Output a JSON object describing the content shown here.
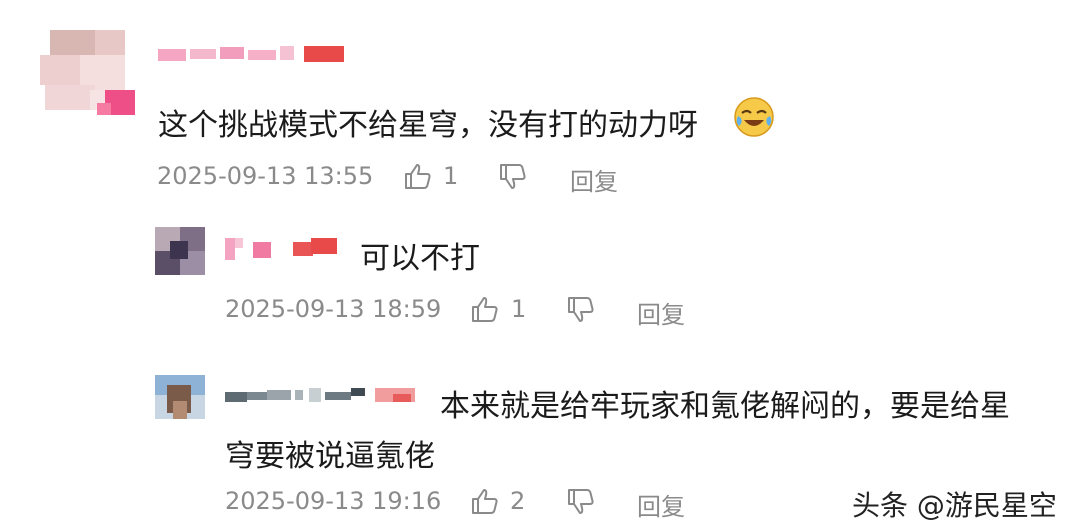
{
  "comments": [
    {
      "text": "这个挑战模式不给星穹，没有打的动力呀",
      "emoji": "crying-laugh-emoji",
      "timestamp": "2025-09-13 13:55",
      "likes": "1",
      "reply_label": "回复"
    },
    {
      "text": "可以不打",
      "timestamp": "2025-09-13 18:59",
      "likes": "1",
      "reply_label": "回复"
    },
    {
      "text_line1": "本来就是给牢玩家和氪佬解闷的，要是给星",
      "text_line2": "穹要被说逼氪佬",
      "timestamp": "2025-09-13 19:16",
      "likes": "2",
      "reply_label": "回复"
    }
  ],
  "watermark": "头条 @游民星空",
  "colors": {
    "meta_gray": "#8a8a8a",
    "text_dark": "#1b1b1b",
    "pink_mosaic": "#f06a93",
    "red_mosaic": "#e84a4a"
  }
}
